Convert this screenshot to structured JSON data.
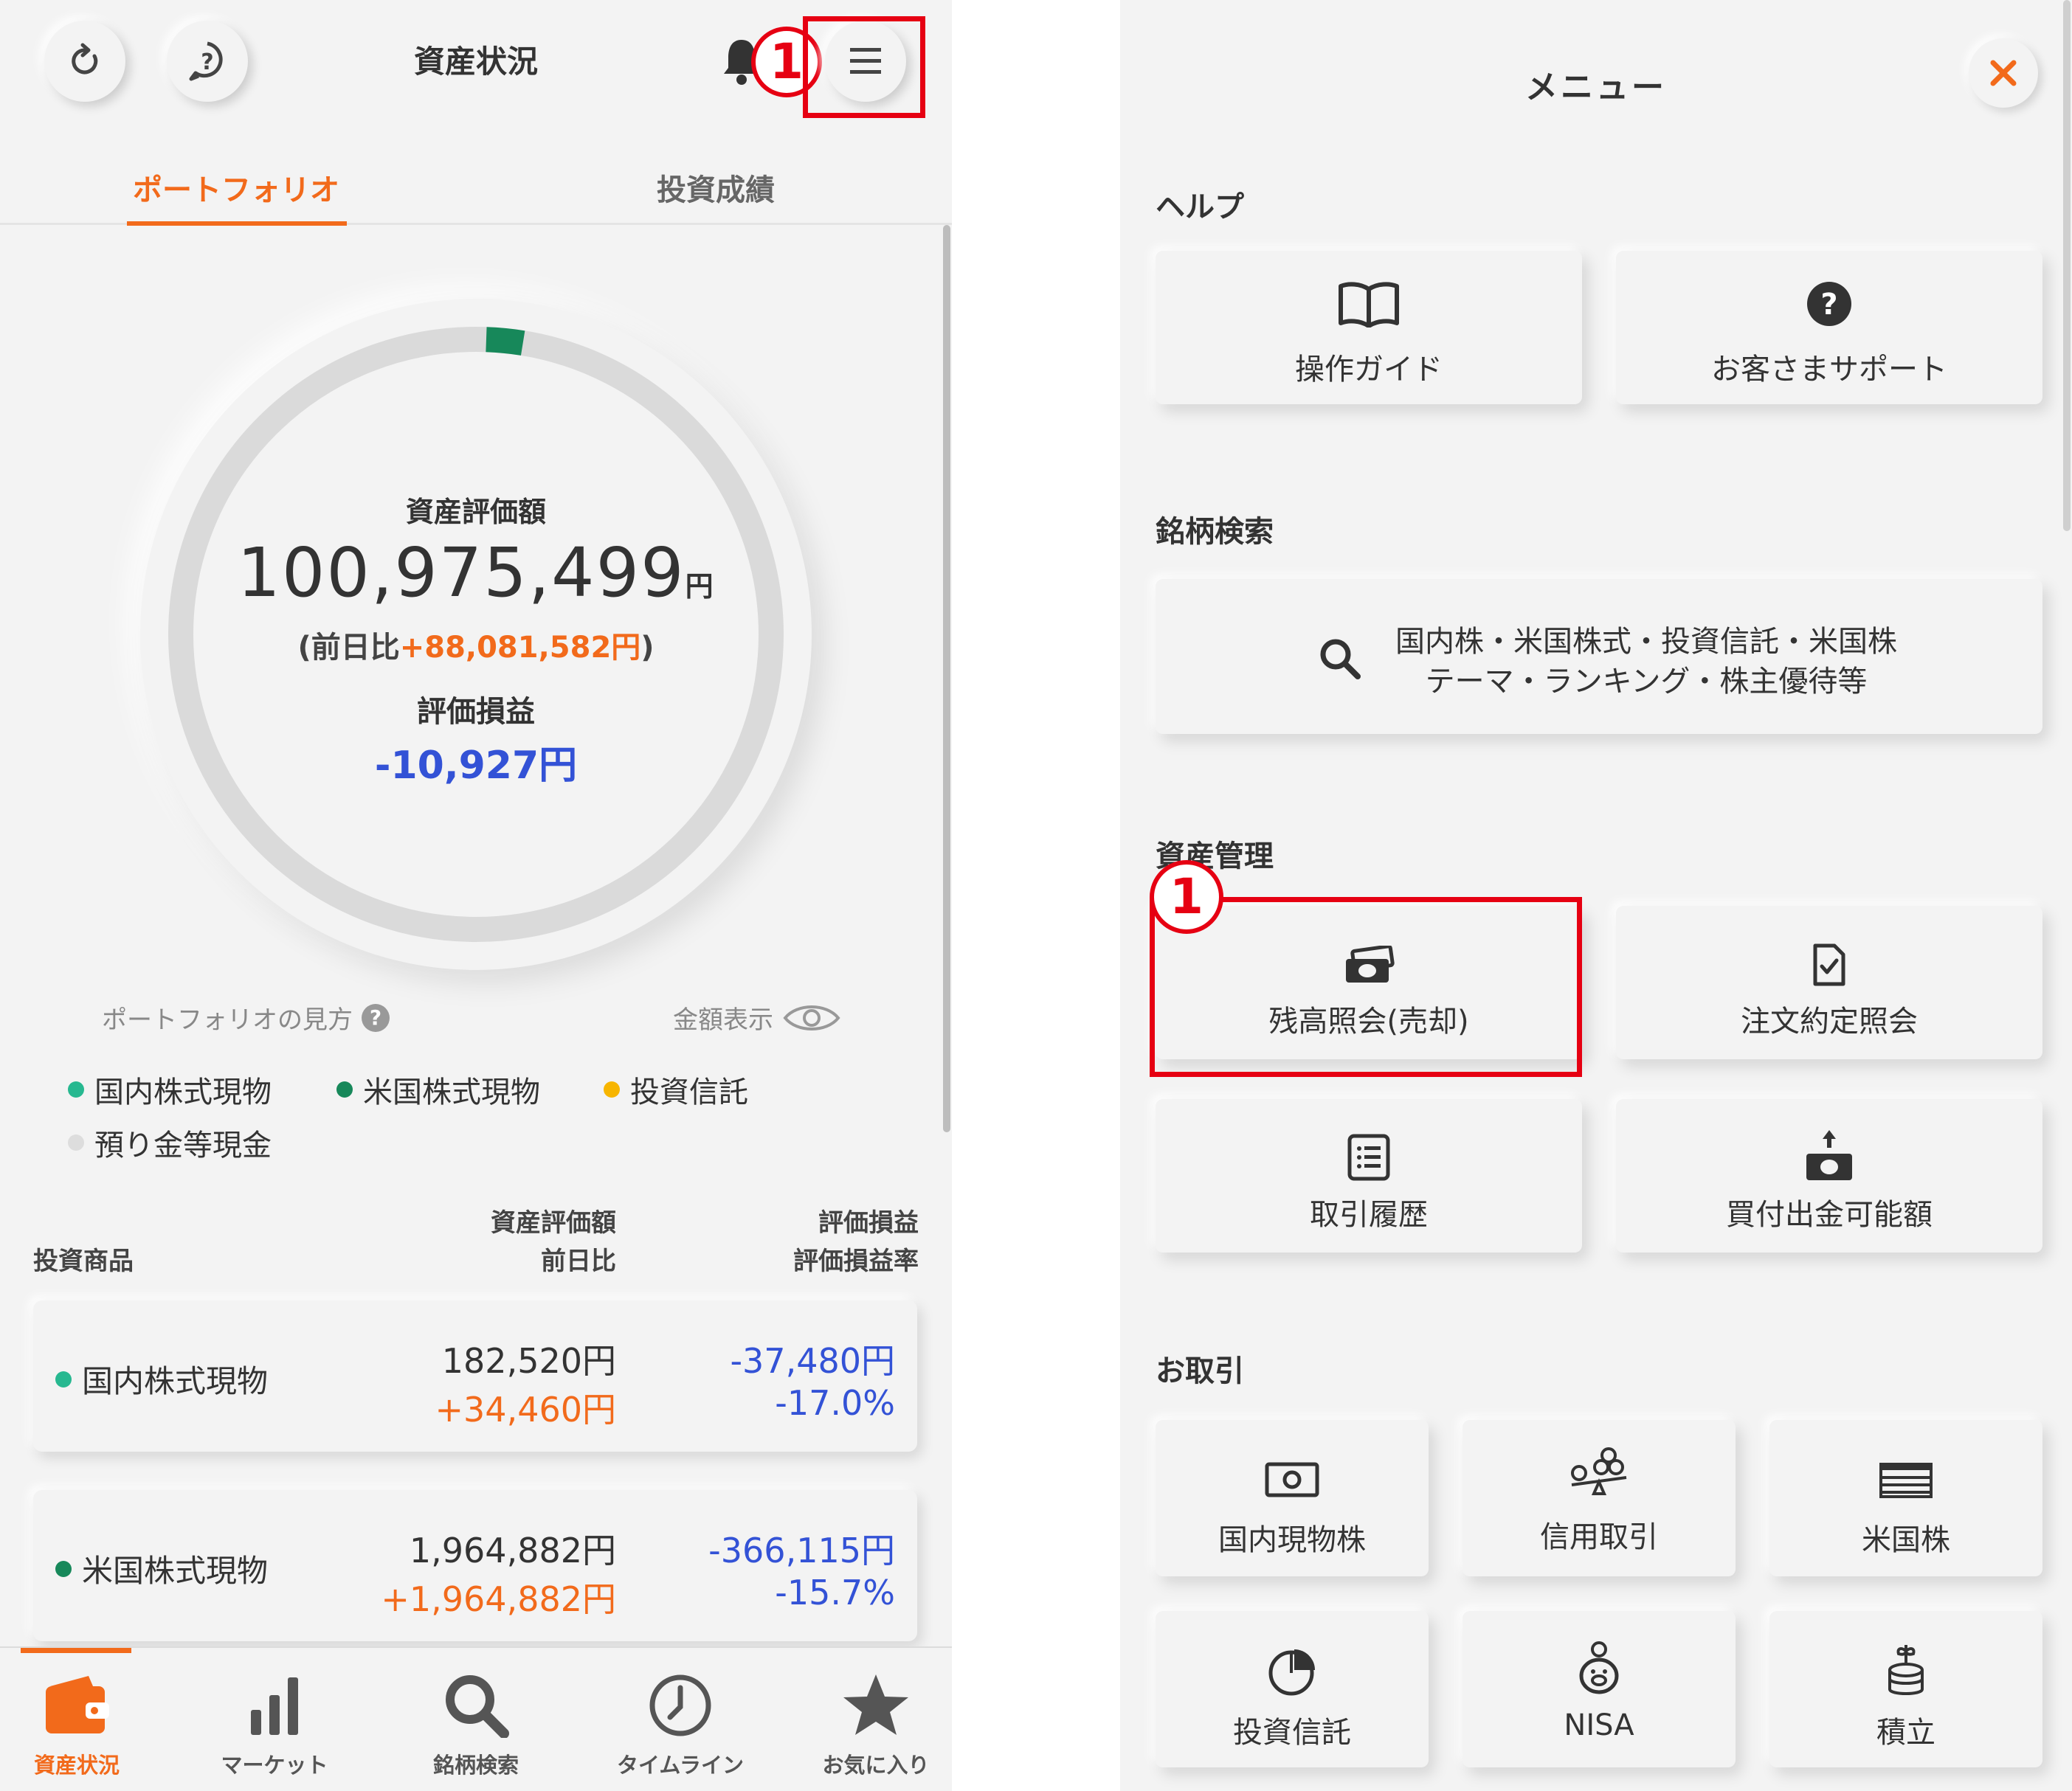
{
  "left": {
    "header": {
      "title": "資産状況",
      "refresh_icon": "refresh-icon",
      "help_icon": "help-icon",
      "bell_icon": "bell-icon",
      "menu_icon": "hamburger-menu-icon",
      "step_badge": "1"
    },
    "tabs": [
      {
        "label": "ポートフォリオ",
        "active": true
      },
      {
        "label": "投資成績",
        "active": false
      }
    ],
    "summary": {
      "label": "資産評価額",
      "amount": "100,975,499",
      "amount_unit": "円",
      "diff_prefix": "(前日比",
      "diff_value": "+88,081,582円",
      "diff_suffix": ")",
      "pl_label": "評価損益",
      "pl_value": "-10,927円"
    },
    "portfolio_help": "ポートフォリオの見方",
    "amount_toggle": "金額表示",
    "legend": [
      {
        "label": "国内株式現物",
        "color": "#27b890"
      },
      {
        "label": "米国株式現物",
        "color": "#17885a"
      },
      {
        "label": "投資信託",
        "color": "#f7b500"
      },
      {
        "label": "預り金等現金",
        "color": "#dddddd"
      }
    ],
    "table_header": {
      "product": "投資商品",
      "value_line1": "資産評価額",
      "value_line2": "前日比",
      "pl_line1": "評価損益",
      "pl_line2": "評価損益率"
    },
    "rows": [
      {
        "name": "国内株式現物",
        "color": "#27b890",
        "value": "182,520円",
        "diff": "+34,460円",
        "pl": "-37,480円",
        "rate": "-17.0%"
      },
      {
        "name": "米国株式現物",
        "color": "#17885a",
        "value": "1,964,882円",
        "diff": "+1,964,882円",
        "pl": "-366,115円",
        "rate": "-15.7%"
      }
    ],
    "nav": [
      {
        "label": "資産状況",
        "icon": "wallet-icon",
        "active": true
      },
      {
        "label": "マーケット",
        "icon": "bar-chart-icon",
        "active": false
      },
      {
        "label": "銘柄検索",
        "icon": "search-icon",
        "active": false
      },
      {
        "label": "タイムライン",
        "icon": "clock-icon",
        "active": false
      },
      {
        "label": "お気に入り",
        "icon": "star-icon",
        "active": false
      }
    ],
    "colors": {
      "accent": "#f26a1b",
      "positive": "#f26a1b",
      "negative": "#3352d6",
      "highlight": "#e60012"
    }
  },
  "right": {
    "title": "メニュー",
    "close_icon": "close-icon",
    "sections": {
      "help": "ヘルプ",
      "search": "銘柄検索",
      "assets": "資産管理",
      "trade": "お取引"
    },
    "help_tiles": [
      {
        "label": "操作ガイド",
        "icon": "book-icon"
      },
      {
        "label": "お客さまサポート",
        "icon": "question-icon"
      }
    ],
    "search_tile": {
      "line1": "国内株・米国株式・投資信託・米国株",
      "line2": "テーマ・ランキング・株主優待等",
      "icon": "search-icon"
    },
    "asset_tiles": [
      {
        "label": "残高照会(売却)",
        "icon": "money-icon"
      },
      {
        "label": "注文約定照会",
        "icon": "document-check-icon"
      },
      {
        "label": "取引履歴",
        "icon": "list-icon"
      },
      {
        "label": "買付出金可能額",
        "icon": "cash-out-icon"
      }
    ],
    "step_badge": "1",
    "trade_tiles": [
      {
        "label": "国内現物株",
        "icon": "banknote-icon"
      },
      {
        "label": "信用取引",
        "icon": "coins-scale-icon"
      },
      {
        "label": "米国株",
        "icon": "us-flag-icon"
      },
      {
        "label": "投資信託",
        "icon": "pie-chart-icon"
      },
      {
        "label": "NISA",
        "icon": "piggy-bank-icon"
      },
      {
        "label": "積立",
        "icon": "coin-stack-icon"
      }
    ]
  }
}
